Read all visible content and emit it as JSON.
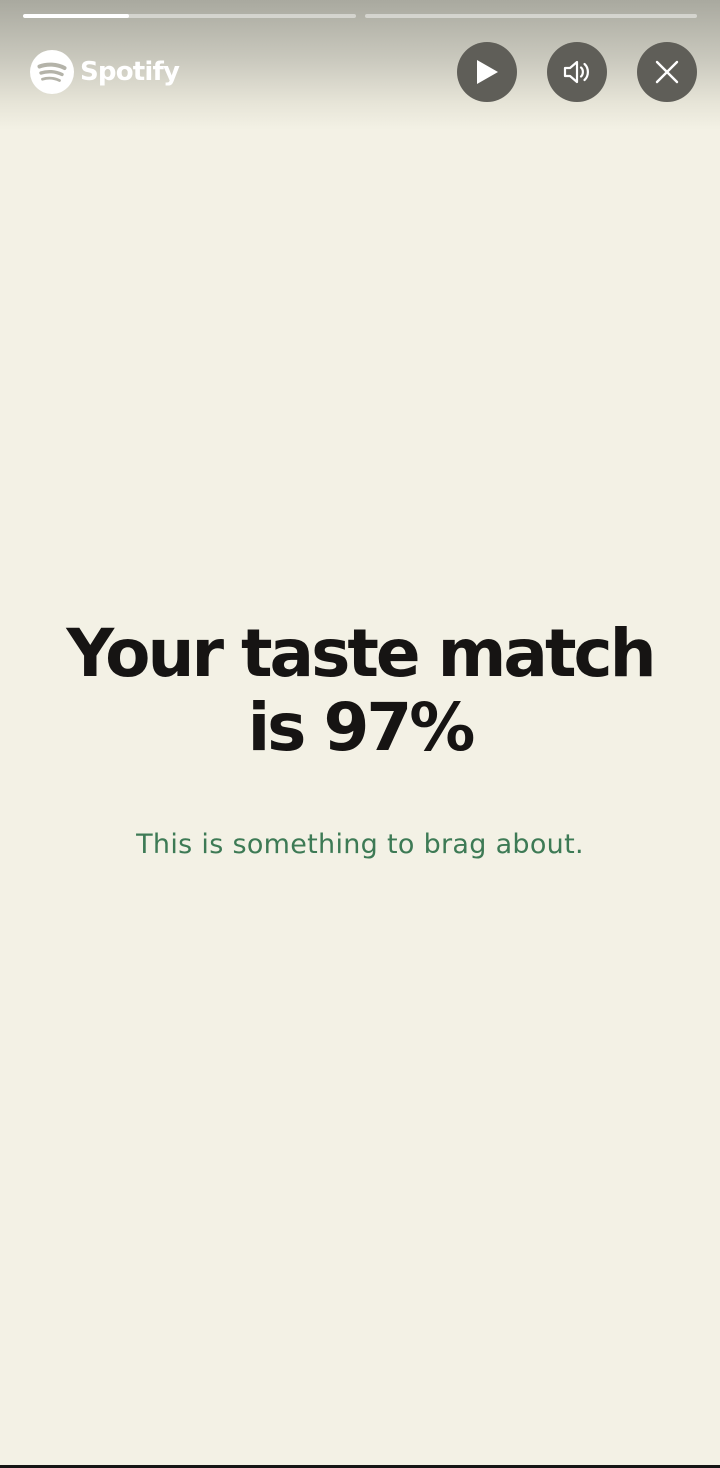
{
  "story": {
    "segments": [
      {
        "progress": 0.32
      },
      {
        "progress": 0.0
      }
    ]
  },
  "header": {
    "brand": "Spotify",
    "buttons": {
      "play_icon": "play-icon",
      "sound_icon": "speaker-icon",
      "close_icon": "close-icon"
    }
  },
  "main": {
    "headline": "Your taste match is 97%",
    "subline": "This is something to brag about."
  },
  "colors": {
    "background": "#f3f1e5",
    "headline": "#161413",
    "subline": "#3d7a55",
    "control_button": "#5f5e58"
  }
}
